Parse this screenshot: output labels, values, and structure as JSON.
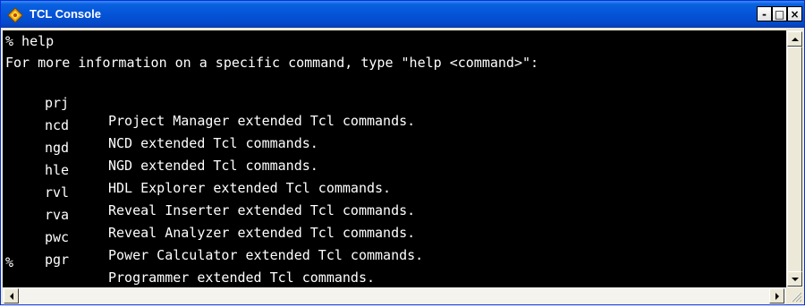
{
  "window": {
    "title": "TCL Console",
    "controls": {
      "minimize": "-",
      "maximize": "□",
      "close": "×"
    }
  },
  "console": {
    "command_line": "% help",
    "info_line": "For more information on a specific command, type \"help <command>\":",
    "commands": [
      {
        "cmd": "prj",
        "desc": "Project Manager extended Tcl commands."
      },
      {
        "cmd": "ncd",
        "desc": "NCD extended Tcl commands."
      },
      {
        "cmd": "ngd",
        "desc": "NGD extended Tcl commands."
      },
      {
        "cmd": "hle",
        "desc": "HDL Explorer extended Tcl commands."
      },
      {
        "cmd": "rvl",
        "desc": "Reveal Inserter extended Tcl commands."
      },
      {
        "cmd": "rva",
        "desc": "Reveal Analyzer extended Tcl commands."
      },
      {
        "cmd": "pwc",
        "desc": "Power Calculator extended Tcl commands."
      },
      {
        "cmd": "pgr",
        "desc": "Programmer extended Tcl commands."
      }
    ],
    "prompt": "%"
  },
  "colors": {
    "console_bg": "#000000",
    "console_text": "#ffffff",
    "titlebar": "#0553d8"
  },
  "icons": {
    "app": "tcl-feather-icon"
  }
}
